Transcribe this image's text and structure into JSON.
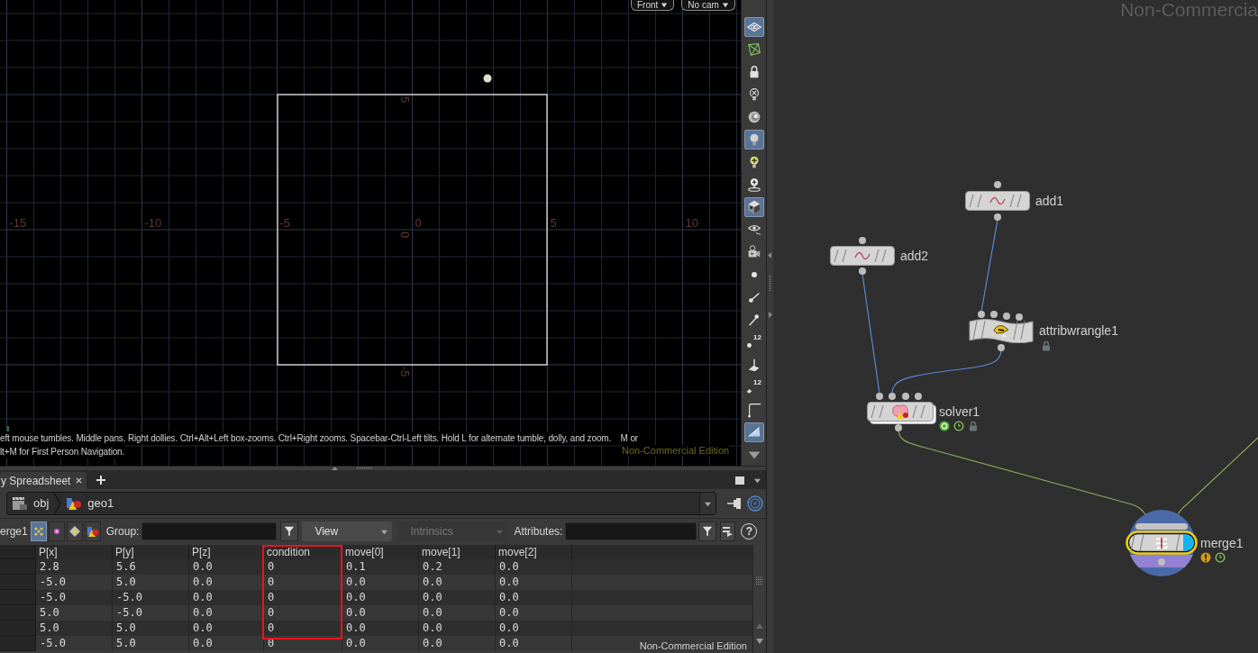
{
  "viewport": {
    "camera_menus": [
      {
        "label": "Front"
      },
      {
        "label": "No cam"
      }
    ],
    "x_axis_labels": [
      "-15",
      "-10",
      "-5",
      "0",
      "5",
      "10"
    ],
    "y_axis_labels": [
      "5",
      "0",
      "-5"
    ],
    "help_lines": [
      "eft mouse tumbles. Middle pans. Right dollies. Ctrl+Alt+Left box-zooms. Ctrl+Right zooms. Spacebar-Ctrl-Left tilts. Hold L for alternate tumble, dolly, and zoom.    M or",
      "lt+M for First Person Navigation."
    ],
    "edition_note": "Non-Commercial Edition",
    "tools": [
      {
        "selected": true
      },
      {
        "selected": false
      },
      {
        "selected": false
      },
      {
        "selected": false
      },
      {
        "selected": false
      },
      {
        "selected": true
      },
      {
        "selected": false
      },
      {
        "selected": false
      },
      {
        "selected": true
      },
      {
        "selected": false
      },
      {
        "selected": false
      },
      {
        "selected": false
      },
      {
        "selected": false
      },
      {
        "selected": false
      },
      {
        "selected": false,
        "badge": "12"
      },
      {
        "selected": false
      },
      {
        "selected": false,
        "badge": "12"
      },
      {
        "selected": false
      },
      {
        "selected": true
      },
      {
        "selected": false
      }
    ]
  },
  "spreadsheet": {
    "tabs": [
      {
        "label": "y Spreadsheet",
        "selected": true
      }
    ],
    "path": [
      {
        "label": "obj"
      },
      {
        "label": "geo1"
      }
    ],
    "node_label": "erge1",
    "component_buttons": [
      {
        "selected": true
      },
      {
        "selected": false
      },
      {
        "selected": false
      },
      {
        "selected": false
      }
    ],
    "group_label": "Group:",
    "view_menu": {
      "value": "View",
      "disabled": false
    },
    "intrinsics_menu": {
      "value": "Intrinsics",
      "disabled": true
    },
    "attributes_label": "Attributes:",
    "help_label": "?",
    "table": {
      "columns": [
        {
          "label": "P[x]",
          "highlighted": false
        },
        {
          "label": "P[y]",
          "highlighted": false
        },
        {
          "label": "P[z]",
          "highlighted": false
        },
        {
          "label": "condition",
          "highlighted": true
        },
        {
          "label": "move[0]",
          "highlighted": false
        },
        {
          "label": "move[1]",
          "highlighted": false
        },
        {
          "label": "move[2]",
          "highlighted": false
        }
      ],
      "rows": [
        [
          "2.8",
          "5.6",
          "0.0",
          "0",
          "0.1",
          "0.2",
          "0.0"
        ],
        [
          "-5.0",
          "5.0",
          "0.0",
          "0",
          "0.0",
          "0.0",
          "0.0"
        ],
        [
          "-5.0",
          "-5.0",
          "0.0",
          "0",
          "0.0",
          "0.0",
          "0.0"
        ],
        [
          "5.0",
          "-5.0",
          "0.0",
          "0",
          "0.0",
          "0.0",
          "0.0"
        ],
        [
          "5.0",
          "5.0",
          "0.0",
          "0",
          "0.0",
          "0.0",
          "0.0"
        ],
        [
          "-5.0",
          "5.0",
          "0.0",
          "0",
          "0.0",
          "0.0",
          "0.0"
        ]
      ]
    },
    "edition_note": "Non-Commercial Edition"
  },
  "network": {
    "edition_note": "Non-Commercia",
    "nodes": [
      {
        "name": "add1",
        "kind": "add",
        "selected": false,
        "display": false,
        "warning": false,
        "sim_cache": false,
        "time_dependent": false,
        "locked": false
      },
      {
        "name": "add2",
        "kind": "add",
        "selected": false,
        "display": false,
        "warning": false,
        "sim_cache": false,
        "time_dependent": false,
        "locked": false
      },
      {
        "name": "attribwrangle1",
        "kind": "wrangle",
        "selected": false,
        "display": false,
        "warning": false,
        "sim_cache": false,
        "time_dependent": false,
        "locked": true
      },
      {
        "name": "solver1",
        "kind": "solver",
        "selected": false,
        "display": false,
        "warning": false,
        "sim_cache": true,
        "time_dependent": true,
        "locked": true
      },
      {
        "name": "merge1",
        "kind": "merge",
        "selected": true,
        "display": true,
        "warning": true,
        "sim_cache": false,
        "time_dependent": true,
        "locked": false
      }
    ]
  }
}
